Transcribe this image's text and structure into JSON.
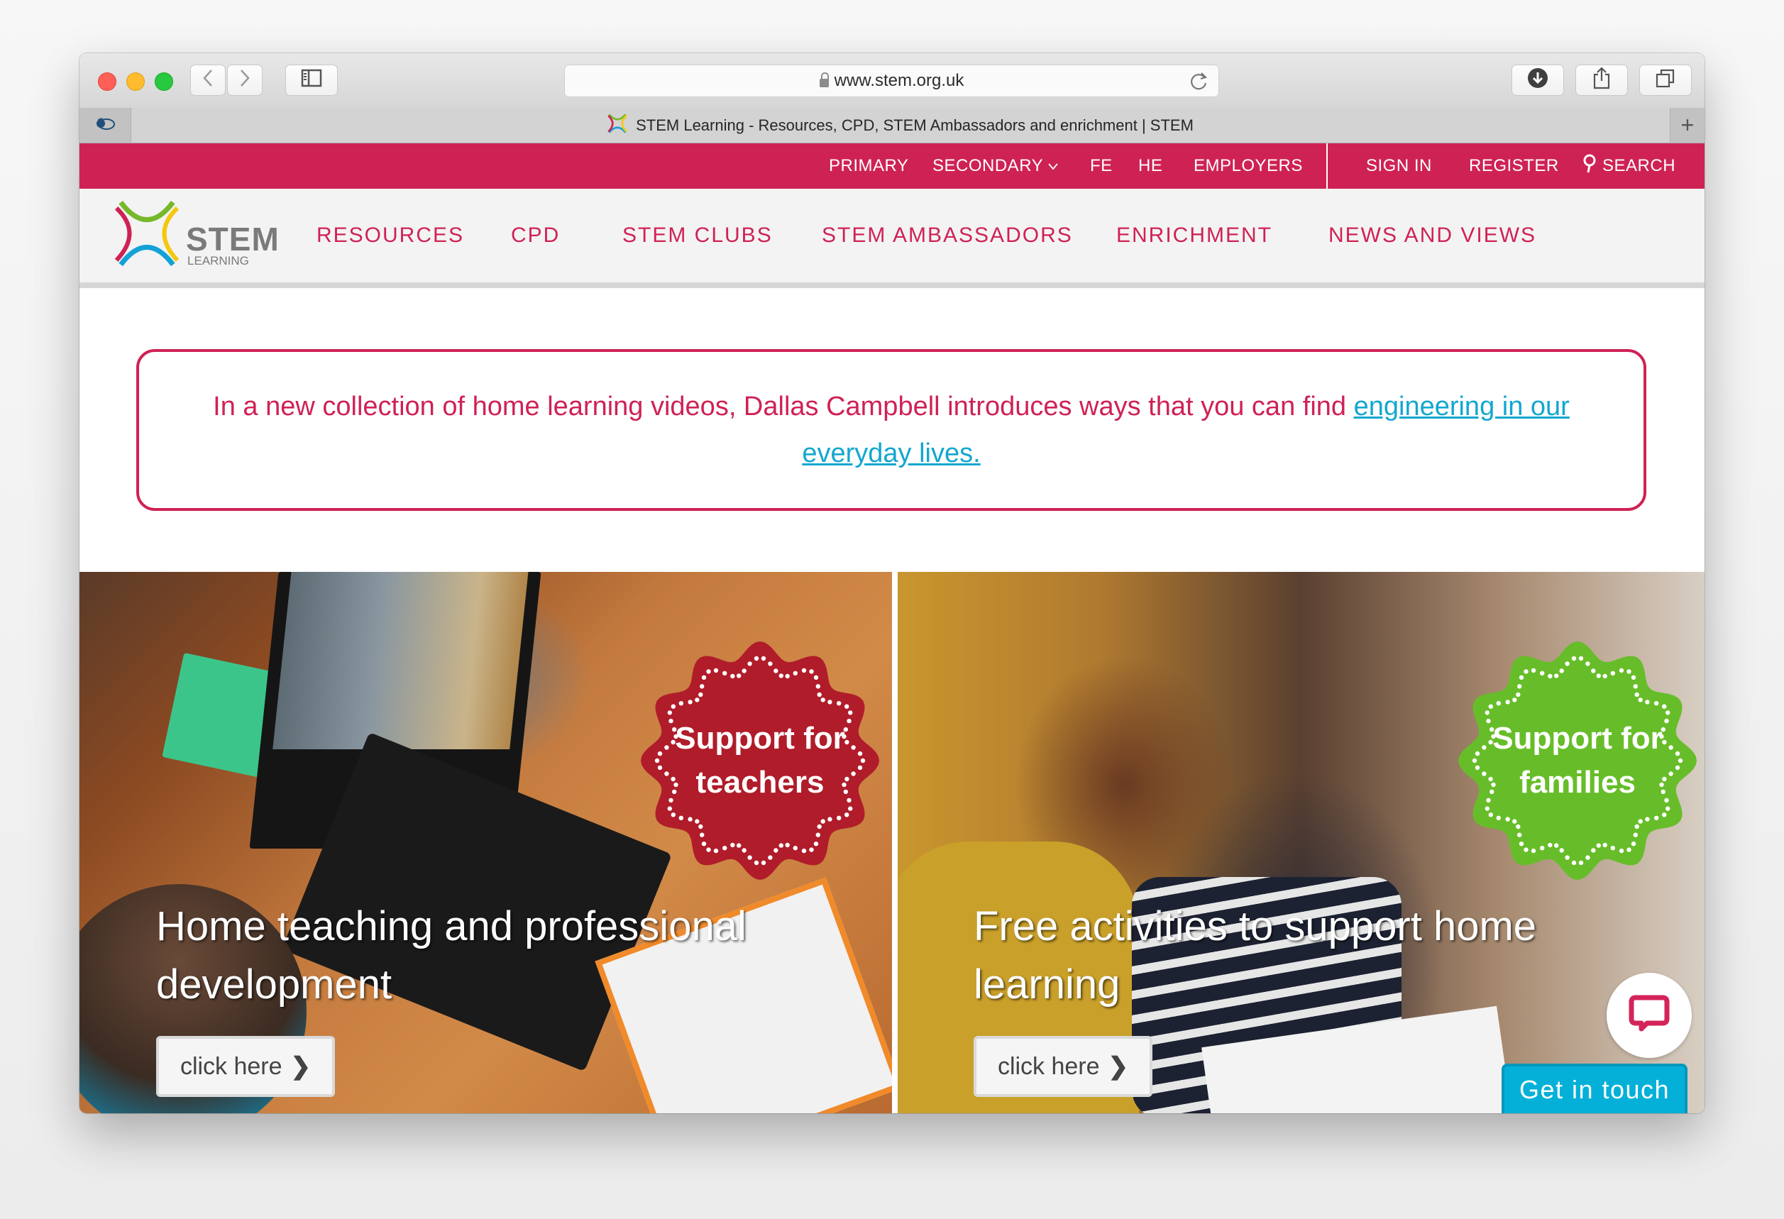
{
  "browser": {
    "url": "www.stem.org.uk",
    "tab_title": "STEM Learning - Resources, CPD, STEM Ambassadors and enrichment | STEM",
    "new_tab_label": "+",
    "icons": {
      "back": "chevron-left-icon",
      "forward": "chevron-right-icon",
      "sidebar": "sidebar-icon",
      "lock": "lock-icon",
      "reload": "reload-icon",
      "download": "download-icon",
      "share": "share-icon",
      "tabs": "tabs-overview-icon"
    }
  },
  "topnav": {
    "items": [
      "PRIMARY",
      "SECONDARY",
      "FE",
      "HE",
      "EMPLOYERS"
    ],
    "secondary_has_dropdown": true,
    "account": [
      "SIGN IN",
      "REGISTER"
    ],
    "search_label": "SEARCH"
  },
  "logo": {
    "name": "STEM",
    "sub": "LEARNING"
  },
  "mainnav": {
    "items": [
      "RESOURCES",
      "CPD",
      "STEM CLUBS",
      "STEM AMBASSADORS",
      "ENRICHMENT",
      "NEWS AND VIEWS"
    ]
  },
  "banner": {
    "text": "In a new collection of home learning videos, Dallas Campbell introduces ways that you can find ",
    "link_text": "engineering in our everyday lives."
  },
  "cards": [
    {
      "badge_line1": "Support for",
      "badge_line2": "teachers",
      "badge_color": "#b01c2a",
      "title": "Home teaching and professional development",
      "button_label": "click here"
    },
    {
      "badge_line1": "Support for",
      "badge_line2": "families",
      "badge_color": "#67bd29",
      "title": "Free activities to support home learning",
      "button_label": "click here"
    }
  ],
  "chat": {
    "icon": "chat-bubble-icon",
    "label": "Get in touch"
  },
  "colors": {
    "brand": "#cf2254",
    "link": "#13a7cf",
    "chat_button": "#04b0d8"
  }
}
